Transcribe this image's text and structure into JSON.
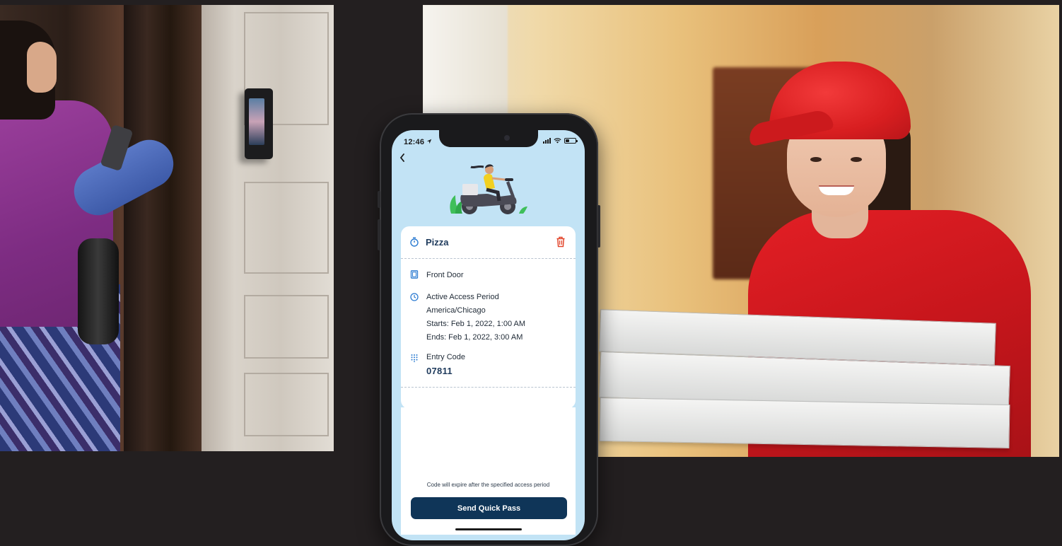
{
  "colors": {
    "background": "#231f20",
    "screen_bg": "#c2e3f5",
    "card_title": "#1e3a5c",
    "accent_blue": "#2b7bd1",
    "danger_red": "#e2452b",
    "button_bg": "#0f3558"
  },
  "status_bar": {
    "time": "12:46",
    "icons": [
      "location-arrow-icon",
      "signal-icon",
      "wifi-icon",
      "battery-icon"
    ]
  },
  "nav": {
    "back_icon": "chevron-left-icon"
  },
  "pass": {
    "name": "Pizza",
    "name_icon": "timer-icon",
    "delete_icon": "trash-icon",
    "door": {
      "icon": "door-icon",
      "label": "Front Door"
    },
    "access": {
      "icon": "clock-icon",
      "label": "Active Access Period",
      "timezone": "America/Chicago",
      "starts": "Starts: Feb 1, 2022, 1:00 AM",
      "ends": "Ends: Feb 1, 2022, 3:00 AM"
    },
    "entry_code": {
      "icon": "keypad-icon",
      "label": "Entry Code",
      "value": "07811"
    }
  },
  "footnote": "Code will expire after the specified access period",
  "send_button": "Send Quick Pass"
}
